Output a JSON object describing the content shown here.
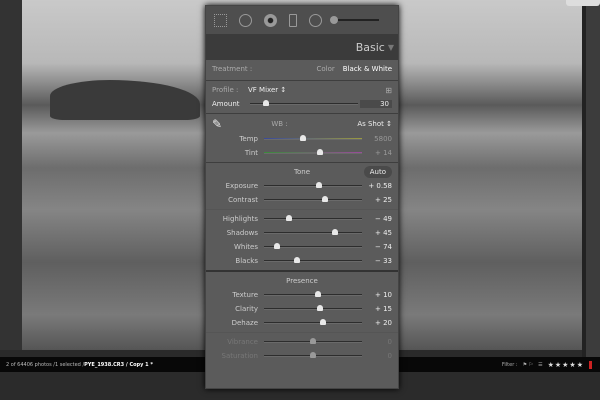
{
  "panel": {
    "title": "Basic",
    "treatment_label": "Treatment :",
    "treatment_color": "Color",
    "treatment_bw": "Black & White",
    "profile_label": "Profile :",
    "profile_value": "VF Mixer ↕",
    "amount_label": "Amount",
    "amount_value": "30",
    "amount_fraction": 0.15,
    "wb_label": "WB :",
    "wb_value": "As Shot ↕",
    "temp": {
      "label": "Temp",
      "value": "5800",
      "fraction": 0.4
    },
    "tint": {
      "label": "Tint",
      "value": "+ 14",
      "fraction": 0.57
    },
    "tone_label": "Tone",
    "auto_label": "Auto",
    "presence_label": "Presence",
    "tone": [
      {
        "label": "Exposure",
        "value": "+ 0.58",
        "fraction": 0.558
      },
      {
        "label": "Contrast",
        "value": "+ 25",
        "fraction": 0.625
      }
    ],
    "tone2": [
      {
        "label": "Highlights",
        "value": "− 49",
        "fraction": 0.255
      },
      {
        "label": "Shadows",
        "value": "+ 45",
        "fraction": 0.725
      },
      {
        "label": "Whites",
        "value": "− 74",
        "fraction": 0.13
      },
      {
        "label": "Blacks",
        "value": "− 33",
        "fraction": 0.335
      }
    ],
    "presence": [
      {
        "label": "Texture",
        "value": "+ 10",
        "fraction": 0.55
      },
      {
        "label": "Clarity",
        "value": "+ 15",
        "fraction": 0.575
      },
      {
        "label": "Dehaze",
        "value": "+ 20",
        "fraction": 0.6
      }
    ],
    "presence2": [
      {
        "label": "Vibrance",
        "value": "0",
        "fraction": 0.5
      },
      {
        "label": "Saturation",
        "value": "0",
        "fraction": 0.5
      }
    ]
  },
  "status": {
    "count": "2 of 64406 photos /1 selected /",
    "file": "PYE_1938.CR3 / Copy 1 *",
    "filter_label": "Filter :",
    "stars": "★★★★★"
  }
}
